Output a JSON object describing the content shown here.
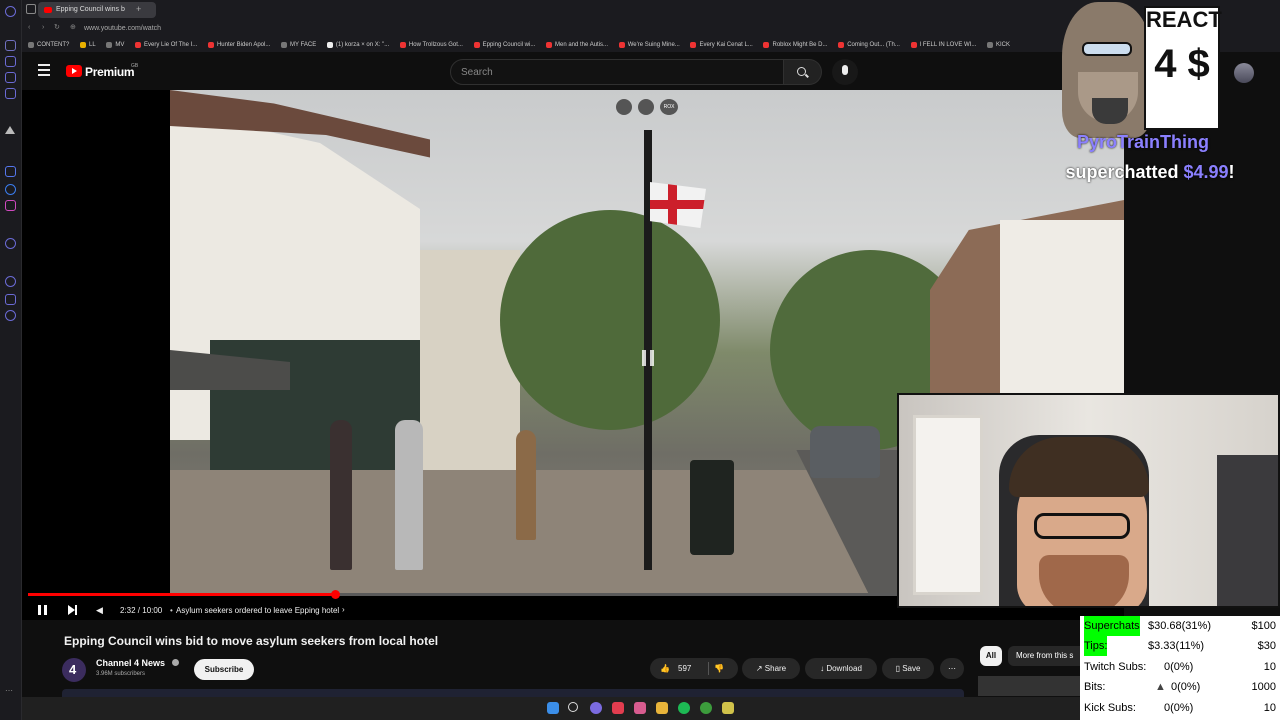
{
  "browser": {
    "tab_title": "Epping Council wins b",
    "url": "www.youtube.com/watch",
    "bookmarks": [
      "CONTENT?",
      "LL",
      "MV",
      "Every Lie Of The I...",
      "Hunter Biden Apol...",
      "MY FACE",
      "(1) korza × on X: \"...",
      "How Trollzous Got...",
      "Epping Council wi...",
      "Men and the Autis...",
      "We're Suing Mine...",
      "Every Kai Cenat L...",
      "Roblox Might Be D...",
      "Coming Out... (Th...",
      "I FELL IN LOVE WI...",
      "KICK"
    ]
  },
  "youtube": {
    "logo_text": "Premium",
    "region": "GB",
    "search_placeholder": "Search",
    "player": {
      "time": "2:32 / 10:00",
      "chapter": "Asylum seekers ordered to leave Epping hotel",
      "progress_fraction": 0.282,
      "overlay_label": "ROX"
    },
    "video_title": "Epping Council wins bid to move asylum seekers from local hotel",
    "channel": {
      "name": "Channel 4 News",
      "subscribers": "3.96M subscribers",
      "subscribe_label": "Subscribe"
    },
    "actions": {
      "likes": "597",
      "share": "Share",
      "download": "Download",
      "save": "Save"
    },
    "chips": {
      "all": "All",
      "more": "More from this s"
    }
  },
  "overlay": {
    "react_text": "REACT",
    "react_price": "4 $",
    "donor_name": "PyroTrainThing",
    "action_text": "superchatted",
    "amount": "$4.99",
    "exclaim": "!"
  },
  "stats": [
    {
      "label": "Superchats",
      "value": "$30.68(31%)",
      "goal": "$100",
      "highlight": true
    },
    {
      "label": "Tips:",
      "value": "$3.33(11%)",
      "goal": "$30",
      "highlight": true
    },
    {
      "label": "Twitch Subs:",
      "value": "0(0%)",
      "goal": "10",
      "highlight": false
    },
    {
      "label": "Bits:",
      "value": "0(0%)",
      "goal": "1000",
      "highlight": false
    },
    {
      "label": "Kick Subs:",
      "value": "0(0%)",
      "goal": "10",
      "highlight": false
    }
  ],
  "colors": {
    "youtube_red": "#ff0000",
    "stat_highlight": "#00ff00",
    "donor_name": "#8b80ff",
    "amount": "#8b80ff"
  }
}
